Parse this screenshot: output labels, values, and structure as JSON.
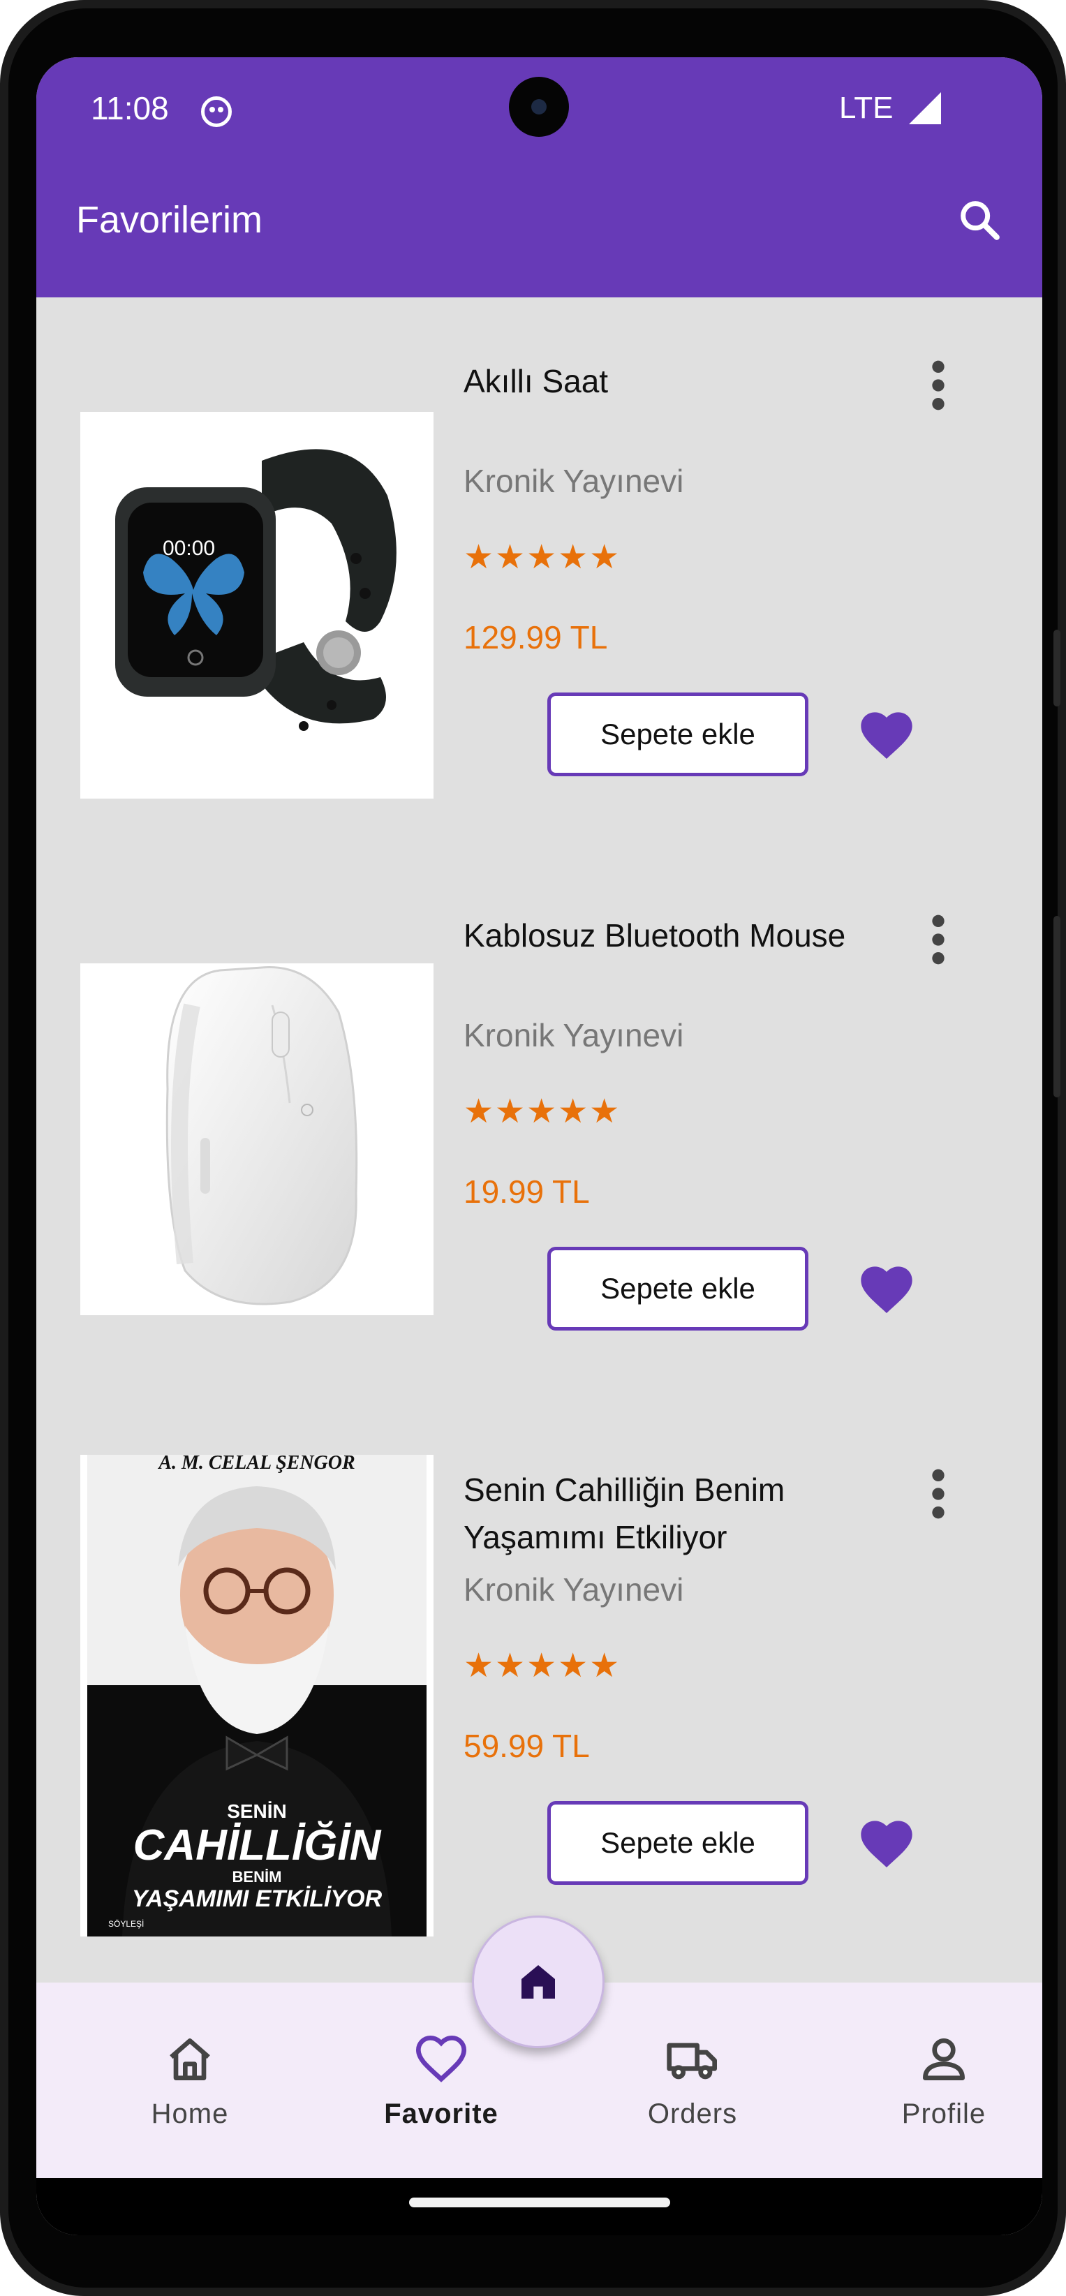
{
  "status_bar": {
    "time": "11:08",
    "network": "LTE"
  },
  "app_bar": {
    "title": "Favorilerim",
    "search_icon": "search-icon"
  },
  "favorites": [
    {
      "title": "Akıllı Saat",
      "publisher": "Kronik Yayınevi",
      "rating_stars": "★★★★★",
      "rating": 5,
      "price": "129.99 TL",
      "add_to_cart_label": "Sepete ekle",
      "image_icon": "smartwatch-image",
      "image_text": "00:00"
    },
    {
      "title": "Kablosuz Bluetooth Mouse",
      "publisher": "Kronik Yayınevi",
      "rating_stars": "★★★★★",
      "rating": 5,
      "price": "19.99 TL",
      "add_to_cart_label": "Sepete ekle",
      "image_icon": "mouse-image"
    },
    {
      "title": "Senin Cahilliğin Benim Yaşamımı Etkiliyor",
      "publisher": "Kronik Yayınevi",
      "rating_stars": "★★★★★",
      "rating": 5,
      "price": "59.99 TL",
      "add_to_cart_label": "Sepete ekle",
      "image_icon": "book-cover-image",
      "cover_author": "A. M. CELAL ŞENGÖR",
      "cover_line_1": "SENİN",
      "cover_line_2": "CAHİLLİĞİN",
      "cover_line_3": "BENİM",
      "cover_line_4": "YAŞAMIMI ETKİLİYOR",
      "cover_footer": "SÖYLEŞİ"
    }
  ],
  "bottom_nav": {
    "items": [
      {
        "label": "Home",
        "icon": "home-icon",
        "active": false
      },
      {
        "label": "Favorite",
        "icon": "heart-icon",
        "active": true
      },
      {
        "label": "Orders",
        "icon": "truck-icon",
        "active": false
      },
      {
        "label": "Profile",
        "icon": "person-icon",
        "active": false
      }
    ],
    "fab_icon": "home-icon"
  },
  "colors": {
    "primary": "#673ab7",
    "accent_orange": "#e8710a",
    "background": "#e0e0e0",
    "nav_background": "#f3ebf9"
  }
}
